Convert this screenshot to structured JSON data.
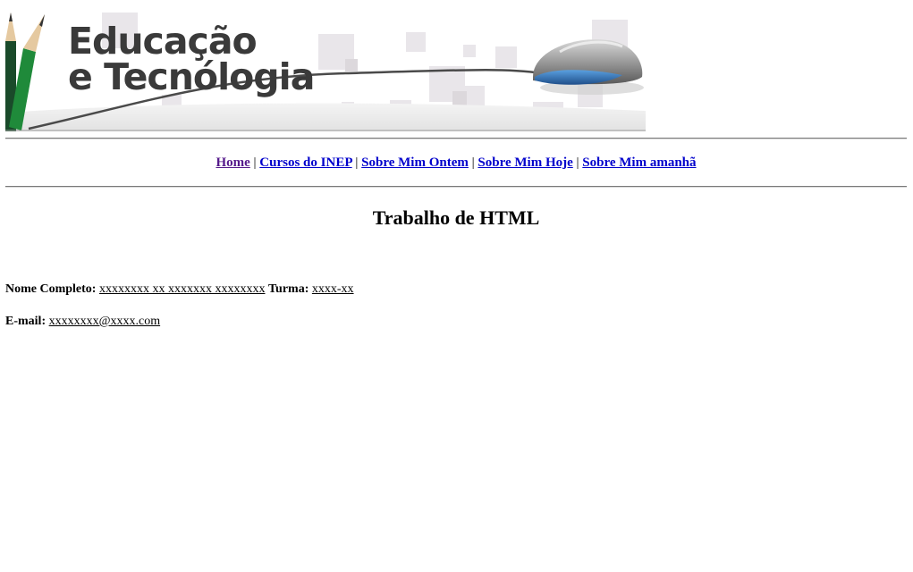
{
  "banner": {
    "line1": "Educação",
    "line2": "e Tecnólogia"
  },
  "nav": {
    "items": [
      {
        "label": "Home",
        "visited": true
      },
      {
        "label": "Cursos do INEP"
      },
      {
        "label": "Sobre Mim Ontem"
      },
      {
        "label": "Sobre Mim Hoje"
      },
      {
        "label": "Sobre Mim amanhã"
      }
    ],
    "separator": "|"
  },
  "main": {
    "title": "Trabalho de HTML",
    "name_label": "Nome Completo:",
    "name_value": "xxxxxxxx xx xxxxxxx xxxxxxxx",
    "class_label": "Turma:",
    "class_value": "xxxx-xx",
    "email_label": "E-mail:",
    "email_value": "xxxxxxxx@xxxx.com"
  },
  "colors": {
    "link": "#0000cc",
    "visited_link": "#551a8b",
    "banner_text": "#3a3a3a",
    "mouse_blue": "#2f6fb0",
    "pencil_green": "#1f8a3a"
  }
}
